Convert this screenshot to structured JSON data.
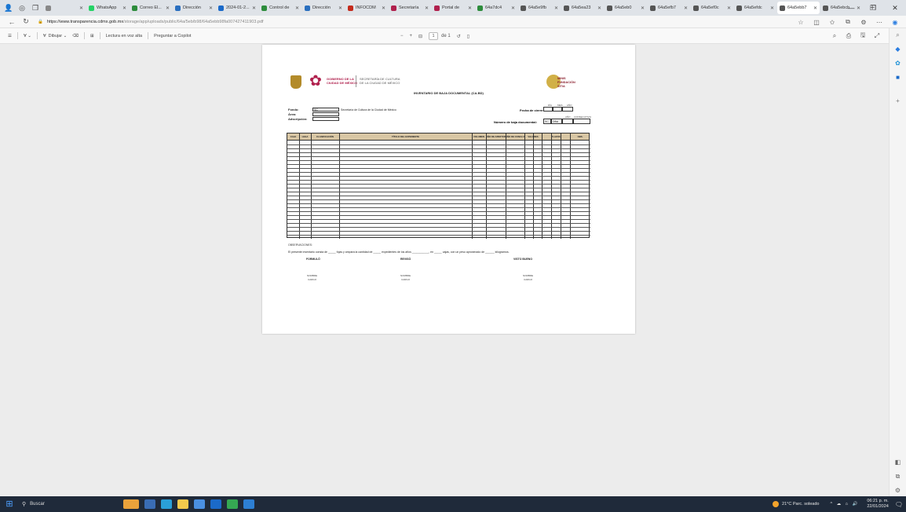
{
  "browser": {
    "tabs": [
      {
        "label": "",
        "color": "#888888"
      },
      {
        "label": "WhatsApp",
        "color": "#25d366"
      },
      {
        "label": "Correo El...",
        "color": "#2d8c3c"
      },
      {
        "label": "Dirección",
        "color": "#2a6fbf"
      },
      {
        "label": "2024-01-2...",
        "color": "#1b6ac9"
      },
      {
        "label": "Control de",
        "color": "#2d8c3c"
      },
      {
        "label": "Dirección",
        "color": "#2a6fbf"
      },
      {
        "label": "INFOCDM",
        "color": "#c42b1c"
      },
      {
        "label": "Secretaría",
        "color": "#b0204d"
      },
      {
        "label": "Portal de",
        "color": "#b0204d"
      },
      {
        "label": "64a7dc4",
        "color": "#2d8c3c"
      },
      {
        "label": "64a5e9fb",
        "color": "#555555"
      },
      {
        "label": "64a5ea23",
        "color": "#555555"
      },
      {
        "label": "64a5eb0",
        "color": "#555555"
      },
      {
        "label": "64a5efb7",
        "color": "#555555"
      },
      {
        "label": "64a5ef0c",
        "color": "#555555"
      },
      {
        "label": "64a5efdc",
        "color": "#555555"
      },
      {
        "label": "64a5ebb7",
        "color": "#555555"
      },
      {
        "label": "64a5ebcb",
        "color": "#555555"
      }
    ],
    "active_tab_index": 17,
    "url_host": "https://www.transparencia.cdmx.gob.mx",
    "url_path": "/storage/app/uploads/public/64a/5eb/b98/64a5ebb98fa007427411903.pdf"
  },
  "pdf_toolbar": {
    "draw_label": "Dibujar",
    "read_aloud_label": "Lectura en voz alta",
    "copilot_label": "Preguntar a Copilot",
    "page_current": "1",
    "page_total": "de 1"
  },
  "doc": {
    "gov_line1": "GOBIERNO DE LA",
    "gov_line2": "CIUDAD DE MÉXICO",
    "sec_line1": "SECRETARÍA DE CULTURA",
    "sec_line2": "DE LA CIUDAD DE MÉXICO",
    "right_logo_line1": "MINIS",
    "right_logo_line2": "FUNDACIÓN",
    "right_logo_line3": "SITIA",
    "title": "INVENTARIO DE BAJA DOCUMENTAL (CA-BD)",
    "fondo_label": "Fondo:",
    "fondo_code": "SC",
    "fondo_value": "Secretaría de Cultura de la Ciudad de México",
    "area_label": "Área:",
    "adscripcion_label": "Adscripción:",
    "cierre_label": "Fecha de cierre:",
    "cierre_headers": [
      "DÍA",
      "MES",
      "AÑO"
    ],
    "baja_label": "Número de baja documental:",
    "baja_headers": [
      "AÑO",
      "CONSECUTIVO"
    ],
    "baja_prefix": "SC",
    "baja_code": "DBA",
    "table_headers": [
      "CAJA",
      "LEGA",
      "CLASIFICACIÓN",
      "TÍTULO DEL EXPEDIENTE",
      "VOLUMEN",
      "AÑO DE APERTURA",
      "AÑO DE CONCLUSIÓN",
      "VALORES",
      "PLAZOS",
      "OBS."
    ],
    "observaciones_label": "OBSERVACIONES:",
    "statement": "El presente inventario consta de _____ fojas y ampara la cantidad de _____ expedientes de los años ___________, en _____ cajas, con un peso aproximado de ______ kilogramos.",
    "sig_elaboro": "FORMULÓ",
    "sig_reviso": "REVISÓ",
    "sig_visto": "VISTO BUENO",
    "sig_nombre": "NOMBRE",
    "sig_cargo": "CARGO"
  },
  "taskbar": {
    "search_label": "Buscar",
    "weather": "21°C Parc. soleado",
    "time": "06:21 p. m.",
    "date": "22/01/2024"
  }
}
